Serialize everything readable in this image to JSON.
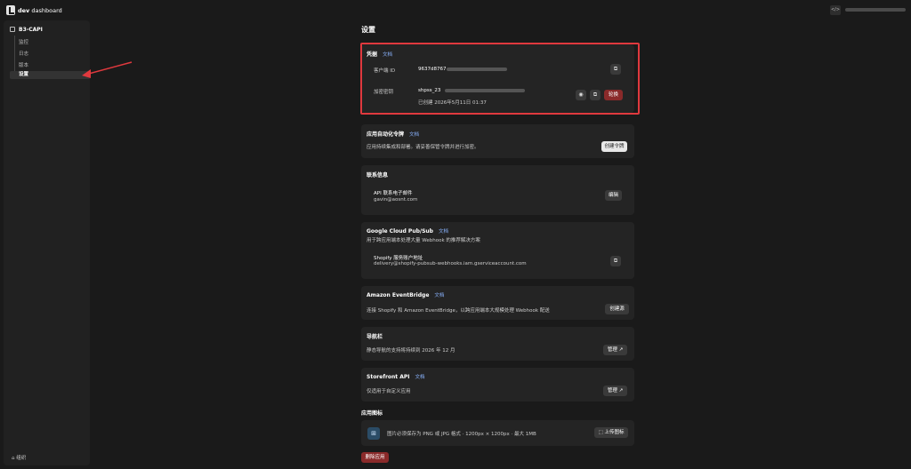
{
  "topbar": {
    "title_bold": "dev",
    "title_rest": " dashboard",
    "code_icon": "code-icon",
    "account_masked": ""
  },
  "sidebar": {
    "app_name": "B3-CAPI",
    "items": [
      {
        "label": "监控"
      },
      {
        "label": "日志"
      },
      {
        "label": "版本"
      },
      {
        "label": "设置"
      }
    ],
    "org_label": "组织"
  },
  "main": {
    "title": "设置",
    "credentials": {
      "title": "凭据",
      "doc": "文档",
      "client_id_label": "客户端 ID",
      "client_id_value": "9637d8767",
      "secret_label": "加密密钥",
      "secret_value": "shpss_23",
      "created": "已创建 2026年5月11日 01:37",
      "rotate": "轮换"
    },
    "auto_token": {
      "title": "应用自动化令牌",
      "doc": "文档",
      "desc": "应用持续集成和部署。请妥善保管令牌并进行加密。",
      "button": "创建令牌"
    },
    "contact": {
      "title": "联系信息",
      "label": "API 联系电子邮件",
      "email": "gavin@aosnt.com",
      "button": "编辑"
    },
    "pubsub": {
      "title": "Google Cloud Pub/Sub",
      "doc": "文档",
      "desc": "用于跨应用端本处理大量 Webhook 的推荐解决方案",
      "label": "Shopify 服务账户地址",
      "value": "delivery@shopify-pubsub-webhooks.iam.gserviceaccount.com"
    },
    "eventbridge": {
      "title": "Amazon EventBridge",
      "doc": "文档",
      "desc": "连接 Shopify 和 Amazon EventBridge，以跨应用端本大规模处理 Webhook 配送",
      "button": "创建源"
    },
    "navbar": {
      "title": "导航栏",
      "desc": "静态导航的支持将持续到 2026 年 12 月",
      "button": "管理"
    },
    "storefront": {
      "title": "Storefront API",
      "doc": "文档",
      "desc": "仅适用于自定义应用",
      "button": "管理"
    },
    "app_icon": {
      "title": "应用图标",
      "desc": "图片必须保存为 PNG 或 JPG 格式 · 1200px × 1200px · 最大 1MB",
      "button": "上传图标"
    },
    "delete": "删除应用"
  }
}
